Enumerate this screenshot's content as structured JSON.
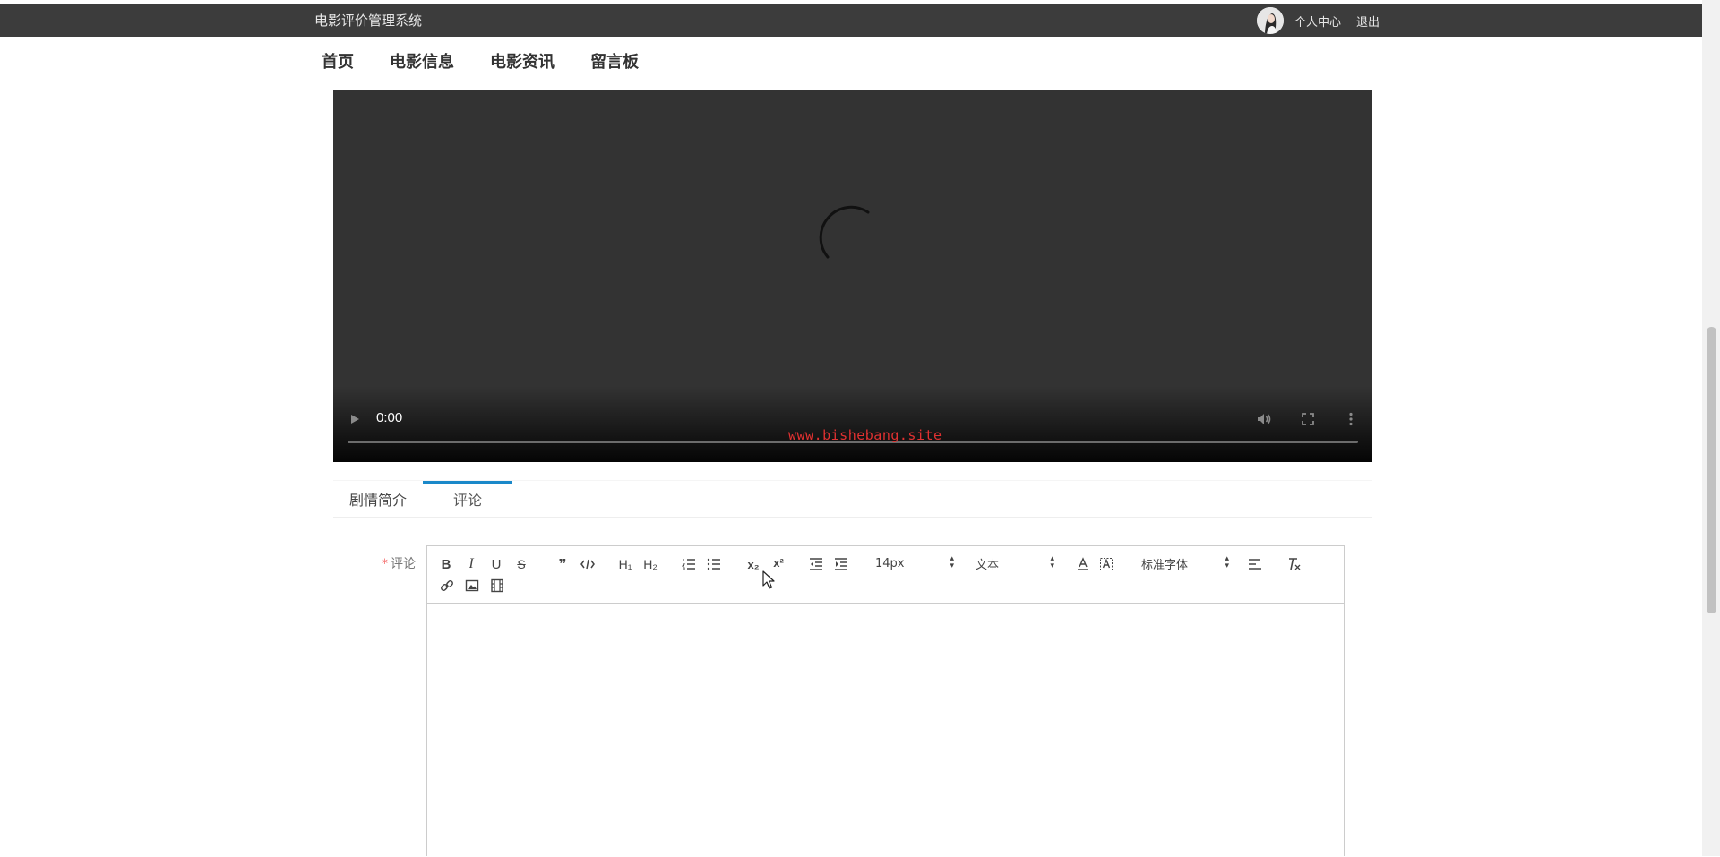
{
  "header": {
    "site_title": "电影评价管理系统",
    "user_center": "个人中心",
    "logout": "退出"
  },
  "nav": {
    "home": "首页",
    "movie_info": "电影信息",
    "movie_news": "电影资讯",
    "message_board": "留言板"
  },
  "video": {
    "time": "0:00",
    "watermark": "www.bishebang.site"
  },
  "tabs": {
    "synopsis": "剧情简介",
    "comments": "评论",
    "active": "评论"
  },
  "form": {
    "required_mark": "*",
    "comment_label": "评论"
  },
  "editor": {
    "size_value": "14px",
    "header_value": "文本",
    "font_value": "标准字体",
    "tool_h1": "H₁",
    "tool_h2": "H₂",
    "tool_sub": "x₂",
    "tool_sup": "x²",
    "tool_bold": "B",
    "tool_italic": "I",
    "tool_underline": "U",
    "tool_strike": "S",
    "tool_quote": "❞"
  },
  "colors": {
    "topbar": "#3c3c3c",
    "tab_active": "#1a88c9",
    "watermark": "#e03131",
    "video_bg": "#333333"
  }
}
